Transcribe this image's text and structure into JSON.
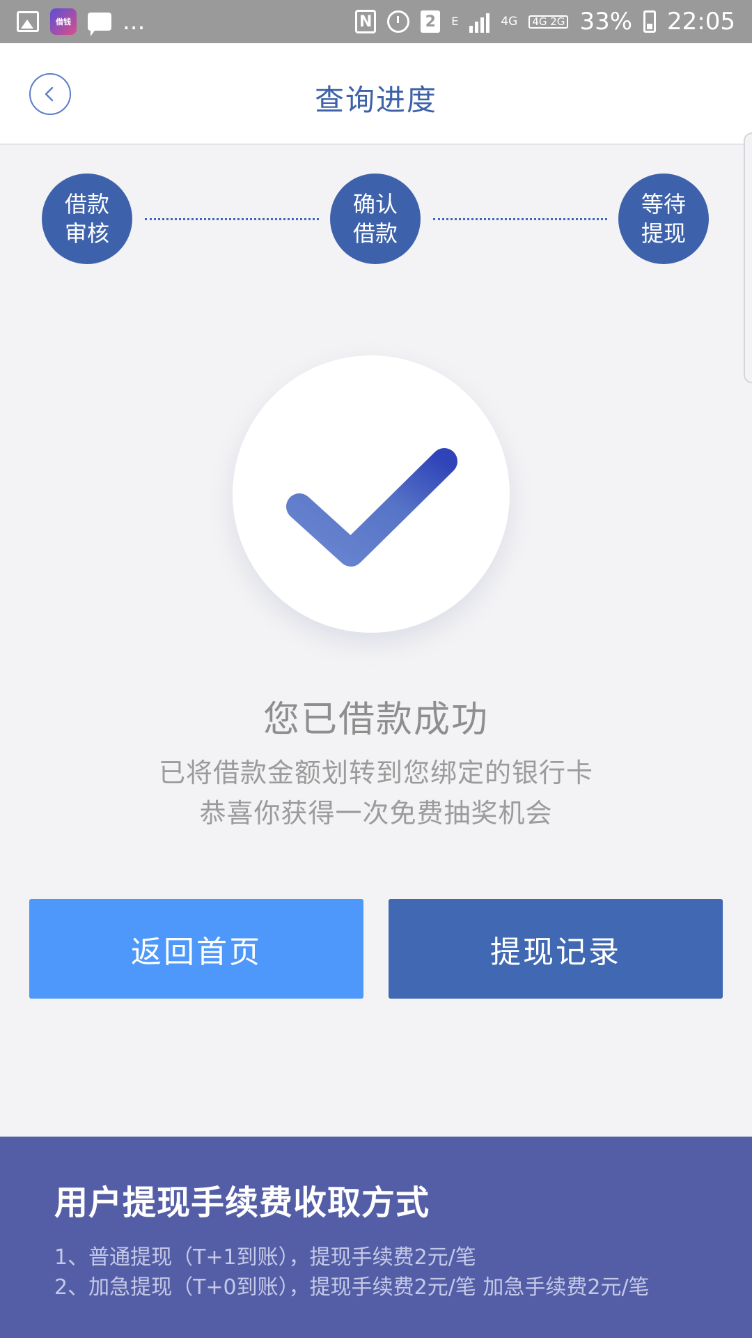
{
  "status_bar": {
    "app_icon_text": "借钱",
    "more": "...",
    "sim_slot": "2",
    "network_e": "E",
    "network_4g": "4G",
    "network_4g2g": "4G 2G",
    "battery": "33%",
    "time": "22:05"
  },
  "header": {
    "title": "查询进度"
  },
  "steps": [
    {
      "label": "借款审核"
    },
    {
      "label": "确认借款"
    },
    {
      "label": "等待提现"
    }
  ],
  "result": {
    "title": "您已借款成功",
    "line1": "已将借款金额划转到您绑定的银行卡",
    "line2": "恭喜你获得一次免费抽奖机会"
  },
  "buttons": {
    "home": "返回首页",
    "records": "提现记录"
  },
  "fee_info": {
    "title": "用户提现手续费收取方式",
    "items": [
      "1、普通提现（T+1到账），提现手续费2元/笔",
      "2、加急提现（T+0到账），提现手续费2元/笔   加急手续费2元/笔"
    ]
  },
  "colors": {
    "accent": "#3d62ab",
    "home_button": "#4e98fb",
    "records_button": "#4068b3",
    "fee_panel": "#545ea6"
  }
}
